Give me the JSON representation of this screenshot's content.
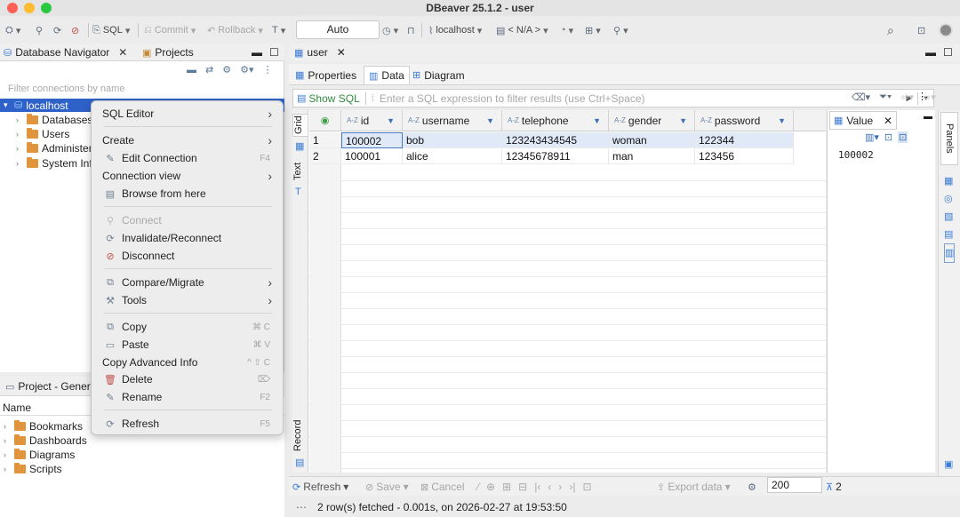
{
  "window": {
    "title": "DBeaver 25.1.2 - user",
    "dot_colors": [
      "#fe5f57",
      "#febc2e",
      "#28c840"
    ]
  },
  "toolbar": {
    "sql_label": "SQL",
    "commit_label": "Commit",
    "rollback_label": "Rollback",
    "transaction_mode": "Auto",
    "datasource": "localhost",
    "schema": "< N/A >"
  },
  "navigator": {
    "tab_label": "Database Navigator",
    "projects_tab_label": "Projects",
    "filter_placeholder": "Filter connections by name",
    "root": "localhost",
    "items": [
      "Databases",
      "Users",
      "Administer",
      "System Info"
    ]
  },
  "project_panel": {
    "tab_label": "Project - General",
    "name_header": "Name",
    "items": [
      "Bookmarks",
      "Dashboards",
      "Diagrams",
      "Scripts"
    ]
  },
  "context_menu": {
    "sql_editor": "SQL Editor",
    "create": "Create",
    "edit_connection": "Edit Connection",
    "edit_connection_sc": "F4",
    "connection_view": "Connection view",
    "browse_from_here": "Browse from here",
    "connect": "Connect",
    "invalidate_reconnect": "Invalidate/Reconnect",
    "disconnect": "Disconnect",
    "compare_migrate": "Compare/Migrate",
    "tools": "Tools",
    "copy": "Copy",
    "copy_sc": "⌘ C",
    "paste": "Paste",
    "paste_sc": "⌘ V",
    "copy_advanced_info": "Copy Advanced Info",
    "copy_advanced_sc": "^ ⇧ C",
    "delete": "Delete",
    "delete_sc": "⌦",
    "rename": "Rename",
    "rename_sc": "F2",
    "refresh": "Refresh",
    "refresh_sc": "F5"
  },
  "editor": {
    "tab_label": "user",
    "subtabs": [
      "Properties",
      "Data",
      "Diagram"
    ],
    "show_sql": "Show SQL",
    "filter_placeholder": "Enter a SQL expression to filter results (use Ctrl+Space)",
    "side_grid": "Grid",
    "side_text": "Text",
    "side_record": "Record"
  },
  "grid": {
    "columns": [
      "id",
      "username",
      "telephone",
      "gender",
      "password"
    ],
    "rows": [
      {
        "num": "1",
        "cells": [
          "100002",
          "bob",
          "123243434545",
          "woman",
          "122344"
        ]
      },
      {
        "num": "2",
        "cells": [
          "100001",
          "alice",
          "12345678911",
          "man",
          "123456"
        ]
      }
    ]
  },
  "value_panel": {
    "tab_label": "Value",
    "value": "100002",
    "panels_label": "Panels"
  },
  "bottom": {
    "refresh": "Refresh",
    "save": "Save",
    "cancel": "Cancel",
    "export": "Export data",
    "fetch_size": "200",
    "row_count": "2",
    "status": "2 row(s) fetched - 0.001s, on 2026-02-27 at 19:53:50"
  }
}
